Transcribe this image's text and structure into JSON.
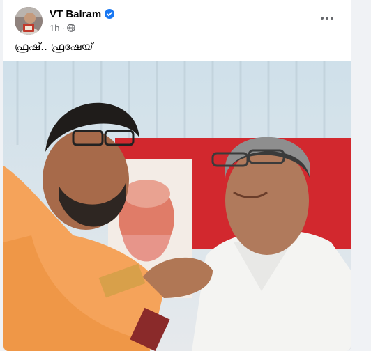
{
  "post": {
    "author": "VT Balram",
    "time": "1h",
    "separator": "·",
    "caption": "ഫ്രഷ്.. ഫ്രഷേയ്"
  },
  "icons": {
    "verified": "verified-badge-icon",
    "audience": "globe-icon",
    "more": "more-options-icon"
  },
  "colors": {
    "verified_blue": "#1877f2",
    "secondary_text": "#65676b",
    "primary_text": "#050505"
  }
}
